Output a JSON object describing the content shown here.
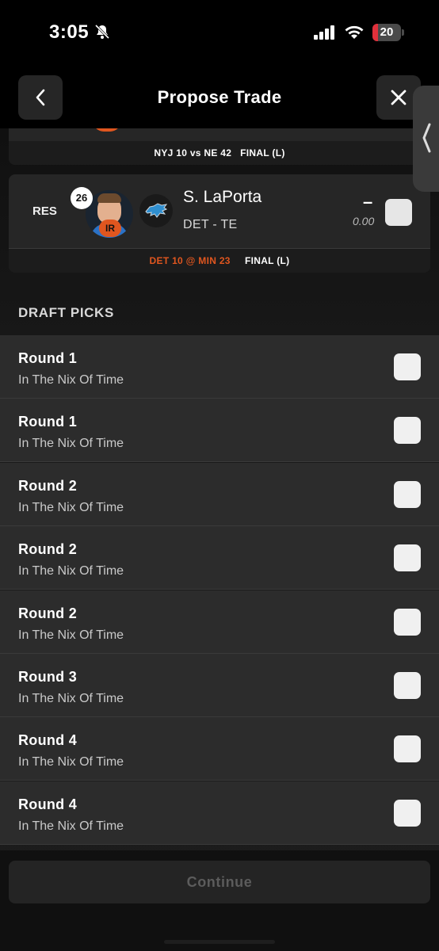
{
  "status_bar": {
    "time": "3:05",
    "battery": "20",
    "battery_level": 0.2,
    "battery_color": "#e0303b",
    "icons": [
      "bell-slash-icon",
      "signal-icon",
      "wifi-icon",
      "battery-icon"
    ]
  },
  "header": {
    "title": "Propose Trade",
    "back_icon": "chevron-left-icon",
    "close_icon": "close-icon"
  },
  "previous_card": {
    "score": "NYJ 10 vs NE 42   FINAL (L)"
  },
  "player": {
    "slot": "RES",
    "number": "26",
    "injury": "IR",
    "team_logo": "lions-logo-icon",
    "name": "S. LaPorta",
    "position": "DET - TE",
    "projection": "–",
    "points": "0.00",
    "game": "DET 10 @ MIN 23",
    "result": "FINAL (L)"
  },
  "draft_picks": {
    "title": "DRAFT PICKS",
    "items": [
      {
        "round": "Round 1",
        "team": "In The Nix Of Time"
      },
      {
        "round": "Round 1",
        "team": "In The Nix Of Time"
      },
      {
        "round": "Round 2",
        "team": "In The Nix Of Time"
      },
      {
        "round": "Round 2",
        "team": "In The Nix Of Time"
      },
      {
        "round": "Round 2",
        "team": "In The Nix Of Time"
      },
      {
        "round": "Round 3",
        "team": "In The Nix Of Time"
      },
      {
        "round": "Round 4",
        "team": "In The Nix Of Time"
      },
      {
        "round": "Round 4",
        "team": "In The Nix Of Time"
      }
    ]
  },
  "footer": {
    "continue_label": "Continue"
  },
  "colors": {
    "accent": "#e0561f",
    "background": "#000000",
    "card": "#262626"
  }
}
